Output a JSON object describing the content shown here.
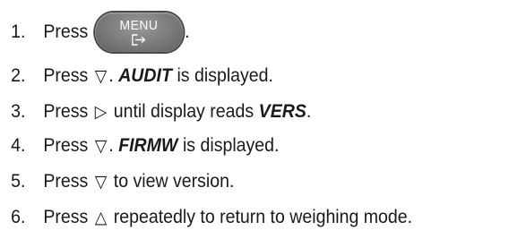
{
  "steps": [
    {
      "num": "1.",
      "text_before": "Press",
      "button_label": "MENU",
      "button_icon": "exit-arrow-icon",
      "text_after": "."
    },
    {
      "num": "2.",
      "text_before": "Press",
      "symbol": "▽",
      "symbol_name": "down-triangle-icon",
      "text_mid": ".",
      "keyword": "AUDIT",
      "text_after": "is displayed."
    },
    {
      "num": "3.",
      "text_before": "Press",
      "symbol": "▷",
      "symbol_name": "right-triangle-icon",
      "text_mid": "until display reads",
      "keyword": "VERS",
      "text_after": "."
    },
    {
      "num": "4.",
      "text_before": "Press",
      "symbol": "▽",
      "symbol_name": "down-triangle-icon",
      "text_mid": ".",
      "keyword": "FIRMW",
      "text_after": "is displayed."
    },
    {
      "num": "5.",
      "text_before": "Press",
      "symbol": "▽",
      "symbol_name": "down-triangle-icon",
      "text_after": "to view version."
    },
    {
      "num": "6.",
      "text_before": "Press",
      "symbol": "△",
      "symbol_name": "up-triangle-icon",
      "text_after": "repeatedly to return to weighing mode."
    }
  ],
  "colors": {
    "text": "#1a1a1a",
    "button_bg": "#7a7a7a",
    "button_text": "#ffffff"
  }
}
